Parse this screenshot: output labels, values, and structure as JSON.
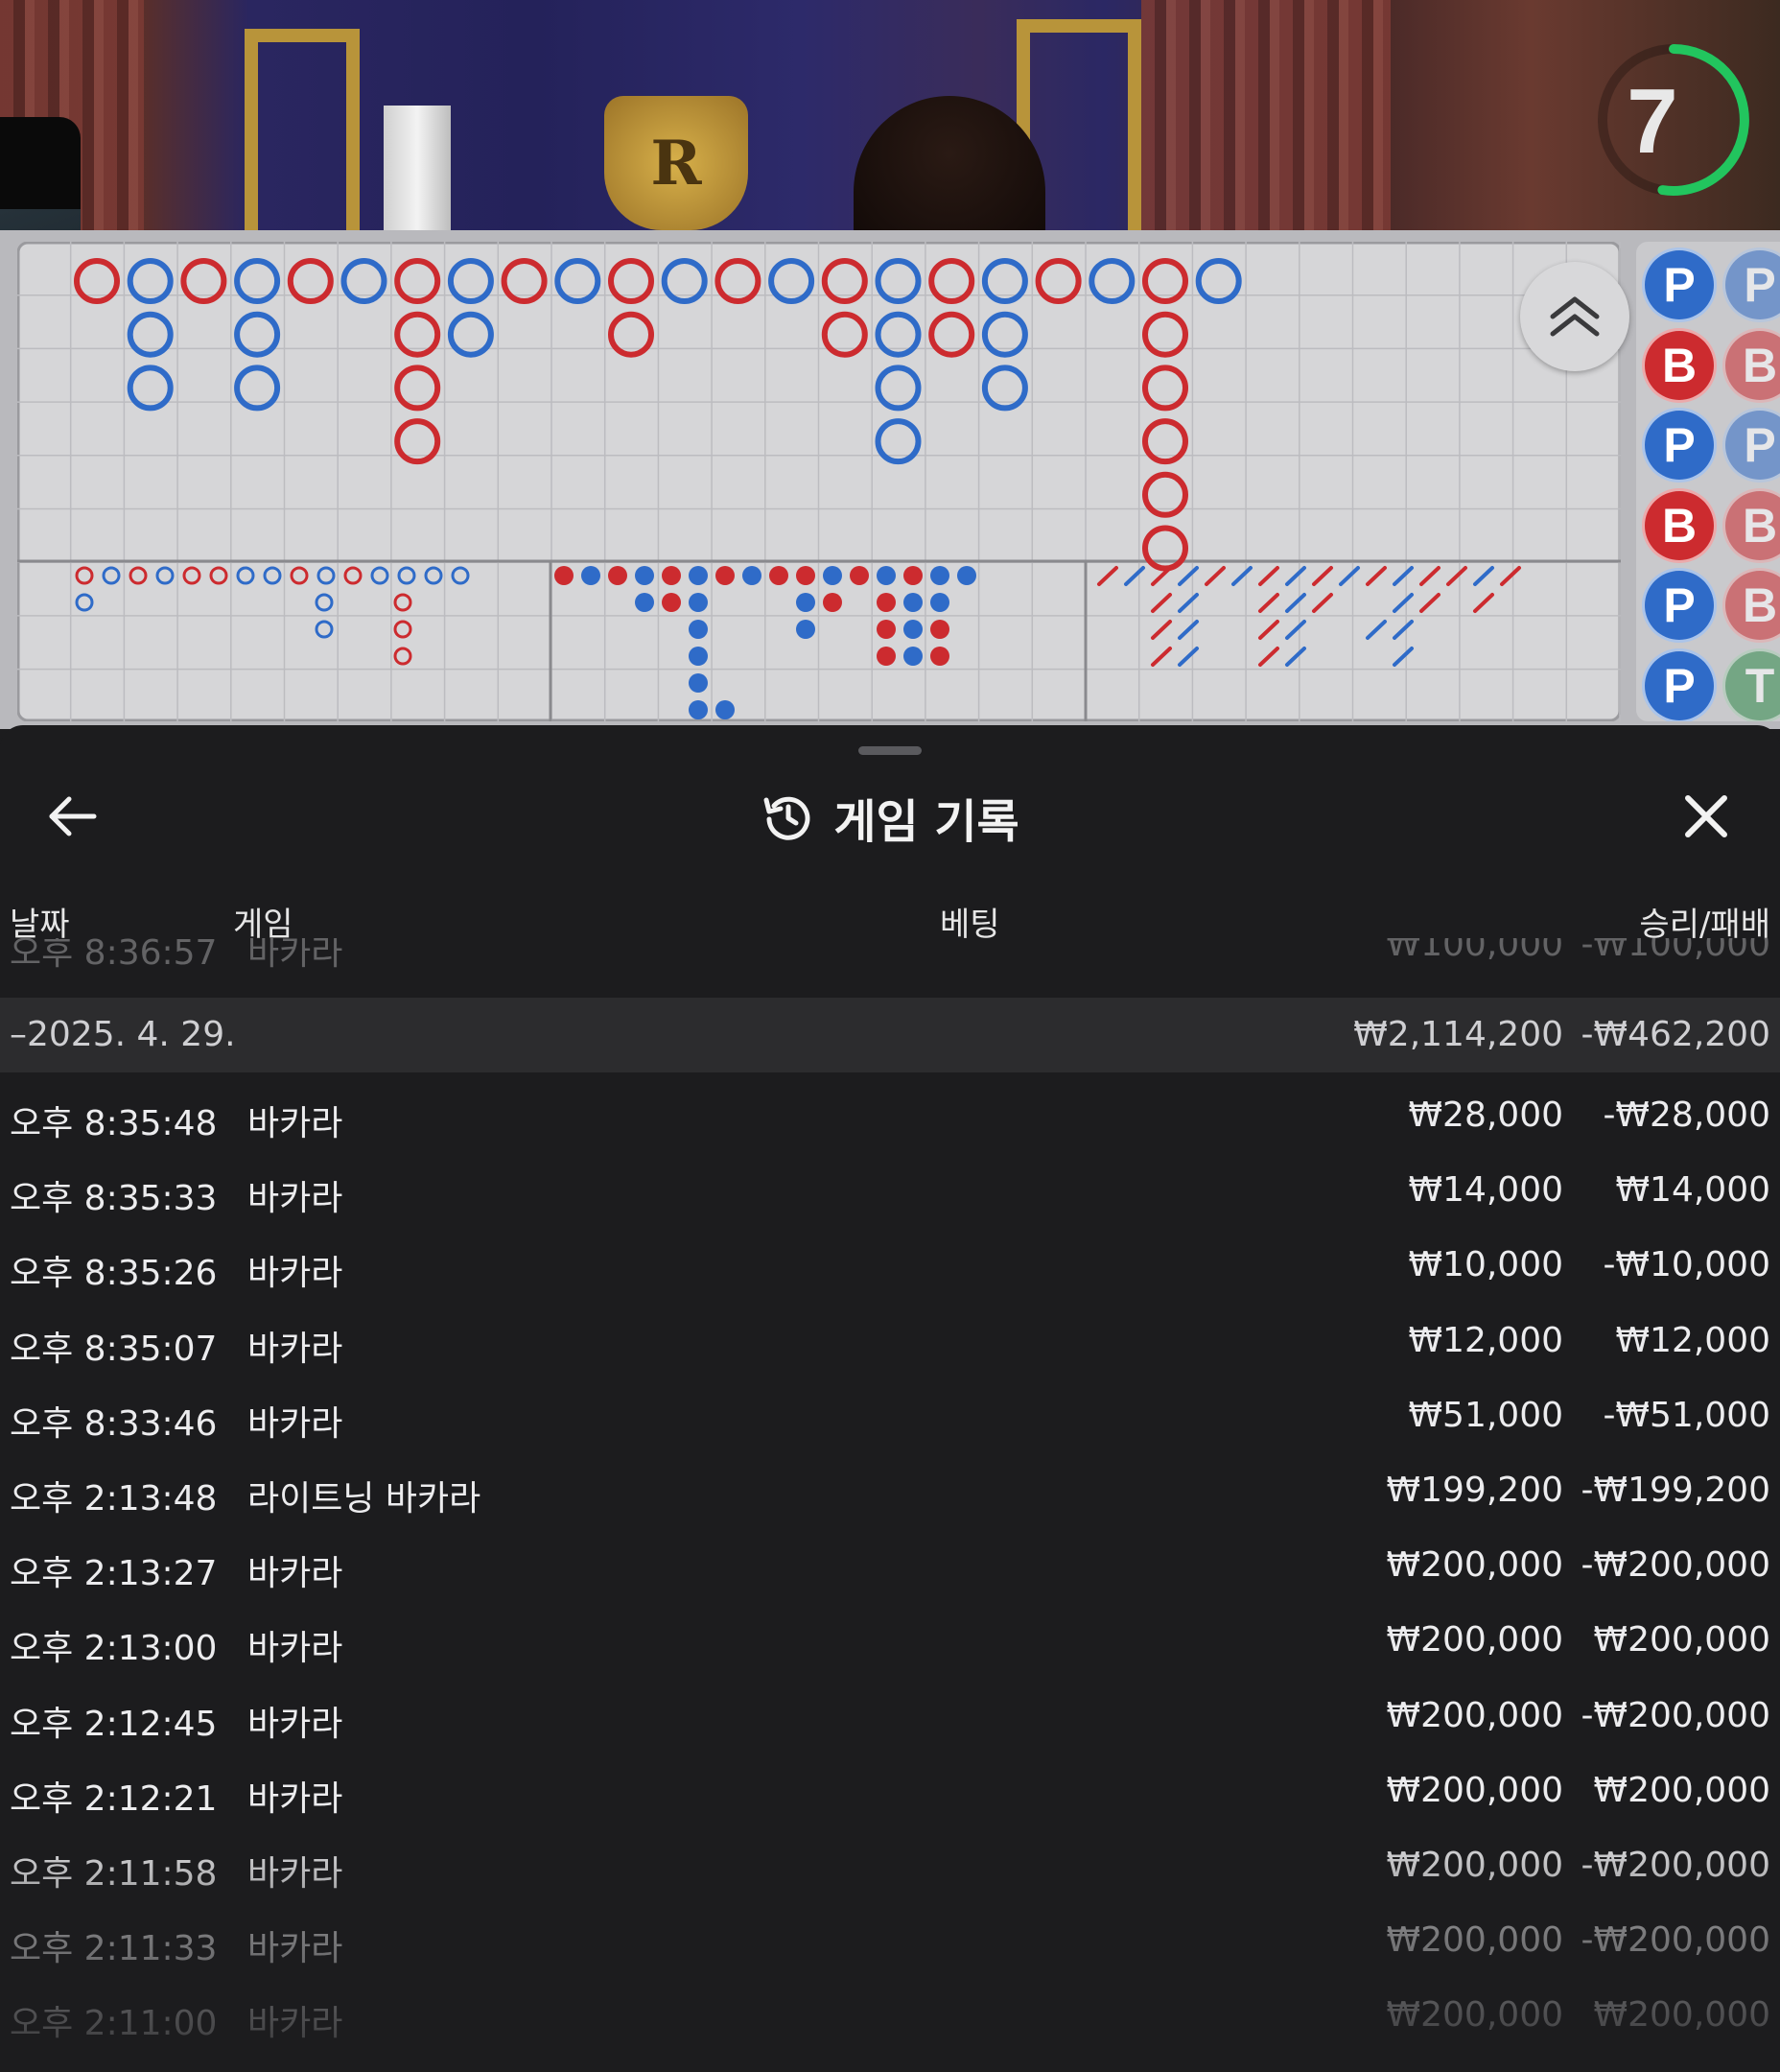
{
  "video": {
    "countdown": "7",
    "crest_letter": "R",
    "colors": {
      "timer_ring": "#22c55e"
    }
  },
  "scoreboard": {
    "colors": {
      "banker": "#cc2b2f",
      "player": "#2f6bc8",
      "tie": "#2f8a4a"
    },
    "big_road": [
      [
        "B"
      ],
      [
        "P",
        "P",
        "P"
      ],
      [
        "B"
      ],
      [
        "P",
        "P",
        "P"
      ],
      [
        "B"
      ],
      [
        "P"
      ],
      [
        "B",
        "B",
        "B",
        "B"
      ],
      [
        "P",
        "P"
      ],
      [
        "B"
      ],
      [
        "P"
      ],
      [
        "B",
        "B"
      ],
      [
        "P"
      ],
      [
        "B"
      ],
      [
        "P"
      ],
      [
        "B",
        "B"
      ],
      [
        "P",
        "P",
        "P",
        "P"
      ],
      [
        "B",
        "B"
      ],
      [
        "P",
        "P",
        "P"
      ],
      [
        "B"
      ],
      [
        "P"
      ],
      [
        "B",
        "B",
        "B",
        "B",
        "B",
        "B"
      ],
      [
        "P"
      ]
    ],
    "bead_road": [
      [
        "P",
        "B",
        "P",
        "B",
        "P",
        "P"
      ],
      [
        "P",
        "B",
        "P",
        "B",
        "B",
        "T"
      ]
    ]
  },
  "history": {
    "title": "게임 기록",
    "columns": {
      "date": "날짜",
      "game": "게임",
      "bet": "베팅",
      "result": "승리/패배"
    },
    "faded_top": {
      "time": "오후 8:36:57",
      "game": "바카라",
      "bet": "₩100,000",
      "result": "-₩100,000"
    },
    "day": {
      "date": "–2025. 4. 29.",
      "bet_total": "₩2,114,200",
      "result_total": "-₩462,200"
    },
    "rows": [
      {
        "time": "오후 8:35:48",
        "game": "바카라",
        "bet": "₩28,000",
        "result": "-₩28,000"
      },
      {
        "time": "오후 8:35:33",
        "game": "바카라",
        "bet": "₩14,000",
        "result": "₩14,000"
      },
      {
        "time": "오후 8:35:26",
        "game": "바카라",
        "bet": "₩10,000",
        "result": "-₩10,000"
      },
      {
        "time": "오후 8:35:07",
        "game": "바카라",
        "bet": "₩12,000",
        "result": "₩12,000"
      },
      {
        "time": "오후 8:33:46",
        "game": "바카라",
        "bet": "₩51,000",
        "result": "-₩51,000"
      },
      {
        "time": "오후 2:13:48",
        "game": "라이트닝 바카라",
        "bet": "₩199,200",
        "result": "-₩199,200"
      },
      {
        "time": "오후 2:13:27",
        "game": "바카라",
        "bet": "₩200,000",
        "result": "-₩200,000"
      },
      {
        "time": "오후 2:13:00",
        "game": "바카라",
        "bet": "₩200,000",
        "result": "₩200,000"
      },
      {
        "time": "오후 2:12:45",
        "game": "바카라",
        "bet": "₩200,000",
        "result": "-₩200,000"
      },
      {
        "time": "오후 2:12:21",
        "game": "바카라",
        "bet": "₩200,000",
        "result": "₩200,000"
      },
      {
        "time": "오후 2:11:58",
        "game": "바카라",
        "bet": "₩200,000",
        "result": "-₩200,000"
      },
      {
        "time": "오후 2:11:33",
        "game": "바카라",
        "bet": "₩200,000",
        "result": "-₩200,000"
      },
      {
        "time": "오후 2:11:00",
        "game": "바카라",
        "bet": "₩200,000",
        "result": "₩200,000"
      }
    ]
  }
}
